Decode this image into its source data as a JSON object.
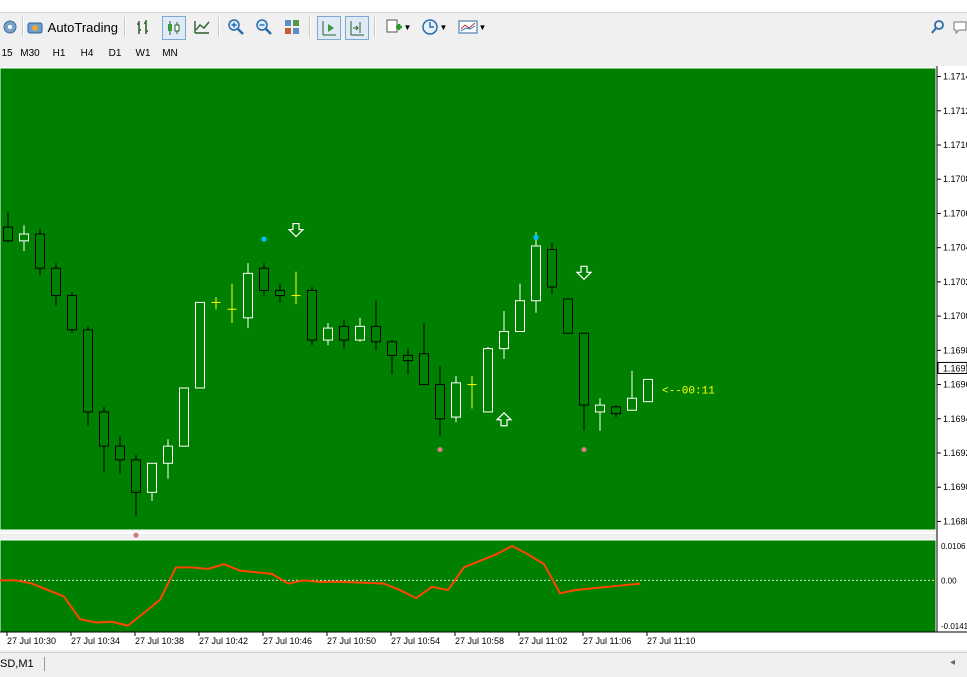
{
  "toolbar": {
    "autotrading_label": "AutoTrading"
  },
  "timeframes": [
    "15",
    "M30",
    "H1",
    "H4",
    "D1",
    "W1",
    "MN"
  ],
  "chart": {
    "background": "#008000",
    "bull_color": "#ffffff",
    "bear_color": "#000000",
    "doji_color": "#ffff00",
    "countdown": "<--00:11",
    "price_axis_labels": [
      "1.1714",
      "1.1712",
      "1.1710",
      "1.1708",
      "1.1706",
      "1.1704",
      "1.1702",
      "1.1700",
      "1.1698",
      "1.1696",
      "1.1694",
      "1.1692",
      "1.1690",
      "1.1688"
    ],
    "current_price_label": "1.1697",
    "indicator_axis_labels": [
      "0.0106",
      "0.00",
      "-0.0141"
    ],
    "time_labels": [
      "27 Jul 10:30",
      "27 Jul 10:34",
      "27 Jul 10:38",
      "27 Jul 10:42",
      "27 Jul 10:46",
      "27 Jul 10:50",
      "27 Jul 10:54",
      "27 Jul 10:58",
      "27 Jul 11:02",
      "27 Jul 11:06",
      "27 Jul 11:10"
    ],
    "indicator_color": "#ff4500",
    "dot_cyan": "#00bfff",
    "dot_pink": "#d08080"
  },
  "chart_data": {
    "type": "candlestick",
    "x": [
      "10:28",
      "10:29",
      "10:30",
      "10:31",
      "10:32",
      "10:33",
      "10:34",
      "10:35",
      "10:36",
      "10:37",
      "10:38",
      "10:39",
      "10:40",
      "10:41",
      "10:42",
      "10:43",
      "10:44",
      "10:45",
      "10:46",
      "10:47",
      "10:48",
      "10:49",
      "10:50",
      "10:51",
      "10:52",
      "10:53",
      "10:54",
      "10:55",
      "10:56",
      "10:57",
      "10:58",
      "10:59",
      "11:00",
      "11:01",
      "11:02",
      "11:03",
      "11:04",
      "11:05",
      "11:06",
      "11:07",
      "11:08",
      "11:09",
      "11:10"
    ],
    "ohlc": [
      [
        1.17052,
        1.17061,
        1.17043,
        1.17044
      ],
      [
        1.17044,
        1.17053,
        1.17038,
        1.17048
      ],
      [
        1.17048,
        1.17051,
        1.17024,
        1.17028
      ],
      [
        1.17028,
        1.17031,
        1.17006,
        1.17012
      ],
      [
        1.17012,
        1.17014,
        1.1699,
        1.16992
      ],
      [
        1.16992,
        1.16994,
        1.16936,
        1.16944
      ],
      [
        1.16944,
        1.16947,
        1.16909,
        1.16924
      ],
      [
        1.16924,
        1.1693,
        1.16908,
        1.16916
      ],
      [
        1.16916,
        1.16919,
        1.16883,
        1.16897
      ],
      [
        1.16897,
        1.16914,
        1.16892,
        1.16914
      ],
      [
        1.16914,
        1.16928,
        1.16905,
        1.16924
      ],
      [
        1.16924,
        1.16958,
        1.16924,
        1.16958
      ],
      [
        1.16958,
        1.17008,
        1.16958,
        1.17008
      ],
      [
        1.17008,
        1.17011,
        1.17004,
        1.17008
      ],
      [
        1.17004,
        1.17019,
        1.16996,
        1.17004
      ],
      [
        1.16999,
        1.17031,
        1.16993,
        1.17025
      ],
      [
        1.17028,
        1.17031,
        1.17012,
        1.17015
      ],
      [
        1.17015,
        1.17019,
        1.17008,
        1.17012
      ],
      [
        1.17012,
        1.17026,
        1.17007,
        1.17012
      ],
      [
        1.17015,
        1.17017,
        1.16983,
        1.16986
      ],
      [
        1.16986,
        1.16996,
        1.16983,
        1.16993
      ],
      [
        1.16994,
        1.16998,
        1.16981,
        1.16986
      ],
      [
        1.16986,
        1.16999,
        1.16985,
        1.16994
      ],
      [
        1.16994,
        1.17009,
        1.1698,
        1.16985
      ],
      [
        1.16985,
        1.16986,
        1.16966,
        1.16977
      ],
      [
        1.16977,
        1.16981,
        1.16966,
        1.16974
      ],
      [
        1.16978,
        1.16996,
        1.16965,
        1.1696
      ],
      [
        1.1696,
        1.16971,
        1.1693,
        1.1694
      ],
      [
        1.16941,
        1.16965,
        1.16938,
        1.16961
      ],
      [
        1.1696,
        1.16965,
        1.16946,
        1.1696
      ],
      [
        1.16944,
        1.16982,
        1.16944,
        1.16981
      ],
      [
        1.16981,
        1.17003,
        1.16975,
        1.16991
      ],
      [
        1.16991,
        1.17019,
        1.16991,
        1.17009
      ],
      [
        1.17009,
        1.17049,
        1.17002,
        1.17041
      ],
      [
        1.17039,
        1.17043,
        1.17013,
        1.17017
      ],
      [
        1.1701,
        1.1701,
        1.1699,
        1.1699
      ],
      [
        1.1699,
        1.1699,
        1.16933,
        1.16948
      ],
      [
        1.16944,
        1.16952,
        1.16933,
        1.16948
      ],
      [
        1.16947,
        1.16948,
        1.16941,
        1.16943
      ],
      [
        1.16945,
        1.16968,
        1.16948,
        1.16952
      ],
      [
        1.1695,
        1.16963,
        1.16956,
        1.16963
      ]
    ],
    "indicator": [
      0.0,
      0.0,
      -0.001,
      -0.003,
      -0.005,
      -0.012,
      -0.013,
      -0.0128,
      -0.014,
      -0.01,
      -0.006,
      0.004,
      0.004,
      0.0035,
      0.005,
      0.003,
      0.0025,
      0.002,
      -0.001,
      0.0,
      -0.0005,
      -0.0004,
      -0.0006,
      -0.0008,
      -0.001,
      -0.003,
      -0.0055,
      -0.002,
      -0.003,
      0.004,
      0.006,
      0.008,
      0.0106,
      0.008,
      0.005,
      -0.004,
      -0.003,
      -0.0025,
      -0.002,
      -0.0015,
      -0.001
    ],
    "yrange": [
      1.16875,
      1.17145
    ],
    "indicator_range": [
      -0.0141,
      0.0106
    ]
  },
  "status": {
    "symbol_label": "SD,M1"
  }
}
